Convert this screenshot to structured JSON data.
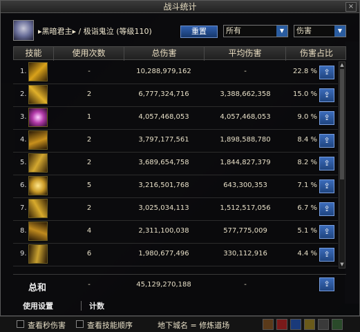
{
  "window": {
    "title": "战斗统计",
    "close_label": "×"
  },
  "header": {
    "character": "▸黑暗君主▸ / 极诣鬼泣 (等级110)",
    "reset_label": "重置",
    "filter_select": "所有",
    "metric_select": "伤害"
  },
  "columns": {
    "skill": "技能",
    "count": "使用次数",
    "total": "总伤害",
    "avg": "平均伤害",
    "share": "伤害占比"
  },
  "rows": [
    {
      "rank": "1.",
      "count": "-",
      "total": "10,288,979,162",
      "avg": "-",
      "share": "22.8 %",
      "color": "#d9a21a"
    },
    {
      "rank": "2.",
      "count": "2",
      "total": "6,777,324,716",
      "avg": "3,388,662,358",
      "share": "15.0 %",
      "color": "#e0b02a"
    },
    {
      "rank": "3.",
      "count": "1",
      "total": "4,057,468,053",
      "avg": "4,057,468,053",
      "share": "9.0 %",
      "color": "#b23aa8"
    },
    {
      "rank": "4.",
      "count": "2",
      "total": "3,797,177,561",
      "avg": "1,898,588,780",
      "share": "8.4 %",
      "color": "#c8901c"
    },
    {
      "rank": "5.",
      "count": "2",
      "total": "3,689,654,758",
      "avg": "1,844,827,379",
      "share": "8.2 %",
      "color": "#d4a830"
    },
    {
      "rank": "6.",
      "count": "5",
      "total": "3,216,501,768",
      "avg": "643,300,353",
      "share": "7.1 %",
      "color": "#c99a28"
    },
    {
      "rank": "7.",
      "count": "2",
      "total": "3,025,034,113",
      "avg": "1,512,517,056",
      "share": "6.7 %",
      "color": "#d8aa2c"
    },
    {
      "rank": "8.",
      "count": "4",
      "total": "2,311,100,038",
      "avg": "577,775,009",
      "share": "5.1 %",
      "color": "#bf8a1e"
    },
    {
      "rank": "9.",
      "count": "6",
      "total": "1,980,677,496",
      "avg": "330,112,916",
      "share": "4.4 %",
      "color": "#c8a030"
    }
  ],
  "total": {
    "label": "总和",
    "count": "-",
    "total": "45,129,270,188",
    "avg": "-"
  },
  "tabs": {
    "settings": "使用设置",
    "count": "计数"
  },
  "status": {
    "check_second_dmg": "查看秒伤害",
    "check_skill_order": "查看技能顺序",
    "dungeon": "地下城名 = 修炼道场"
  }
}
